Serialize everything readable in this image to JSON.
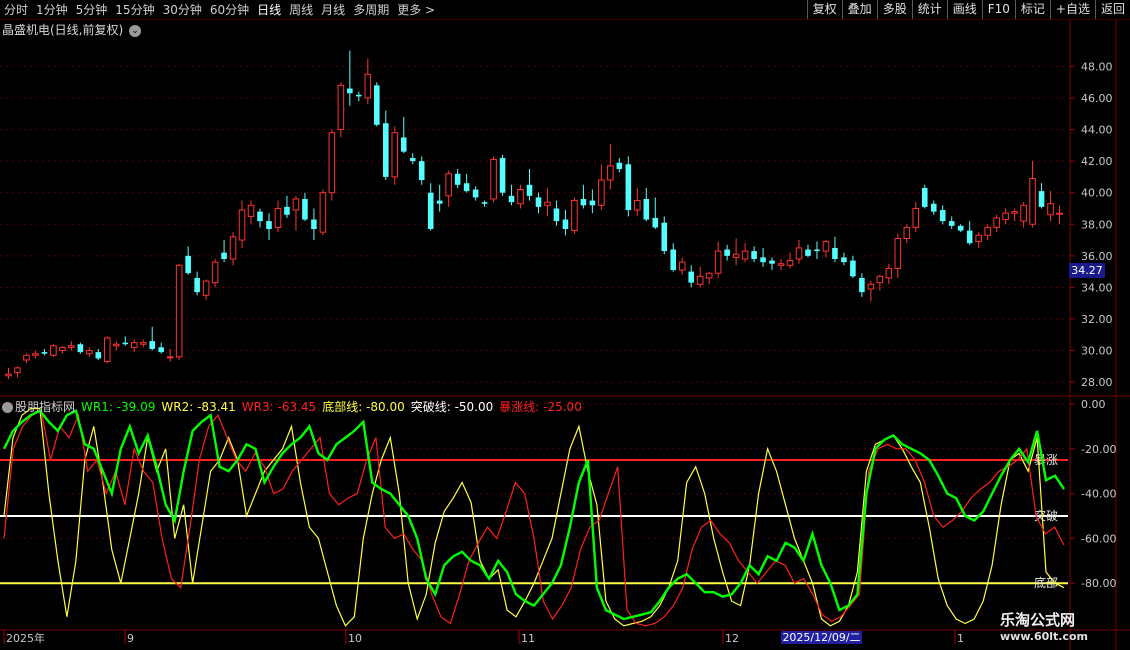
{
  "toolbar": {
    "periods": [
      "分时",
      "1分钟",
      "5分钟",
      "15分钟",
      "30分钟",
      "60分钟",
      "日线",
      "周线",
      "月线",
      "多周期",
      "更多 >"
    ],
    "active_period": "日线",
    "right_buttons": [
      "复权",
      "叠加",
      "多股",
      "统计",
      "画线",
      "F10",
      "标记",
      "+自选",
      "返回"
    ]
  },
  "stock": {
    "title": "晶盛机电(日线,前复权)",
    "current_price_badge": "34.27",
    "price_axis_labels": [
      "48.00",
      "46.00",
      "44.00",
      "42.00",
      "40.00",
      "38.00",
      "36.00",
      "34.00",
      "32.00",
      "30.00",
      "28.00"
    ]
  },
  "indicator": {
    "name": "股朋指标网",
    "wr1": "WR1: -39.09",
    "wr2": "WR2: -83.41",
    "wr3": "WR3: -63.45",
    "bottom_line": "底部线: -80.00",
    "break_line": "突破线: -50.00",
    "surge_line": "暴涨线: -25.00",
    "axis_labels": [
      "0.00",
      "-20.00",
      "-40.00",
      "-60.00",
      "-80.00"
    ],
    "line_labels": {
      "surge": "暴涨",
      "break": "突破",
      "bottom": "底部"
    }
  },
  "time_axis": {
    "labels": [
      "2025年",
      "9",
      "10",
      "11",
      "12",
      "1"
    ],
    "selected_date": "2025/12/09/二"
  },
  "watermark": {
    "line1": "乐淘公式网",
    "line2": "www.60lt.com"
  },
  "colors": {
    "up": "#ff3232",
    "down": "#54ffff",
    "wr1": "#00ff00",
    "wr2": "#ff2020",
    "wr3": "#ffff40",
    "grid": "#5a0000"
  },
  "chart_data": [
    {
      "type": "candlestick",
      "title": "晶盛机电(日线,前复权)",
      "ylim": [
        27.5,
        49.8
      ],
      "candles": [
        [
          28.4,
          28.9,
          28.2,
          28.5
        ],
        [
          28.6,
          29.0,
          28.3,
          28.9
        ],
        [
          29.4,
          29.8,
          29.2,
          29.7
        ],
        [
          29.7,
          30.0,
          29.5,
          29.8
        ],
        [
          29.9,
          30.1,
          29.7,
          29.8
        ],
        [
          29.7,
          30.4,
          29.6,
          30.3
        ],
        [
          30.0,
          30.3,
          29.8,
          30.2
        ],
        [
          30.2,
          30.6,
          30.0,
          30.3
        ],
        [
          30.4,
          30.5,
          29.8,
          29.9
        ],
        [
          29.8,
          30.2,
          29.6,
          30.0
        ],
        [
          29.9,
          30.1,
          29.4,
          29.5
        ],
        [
          29.3,
          30.9,
          29.2,
          30.8
        ],
        [
          30.3,
          30.6,
          30.0,
          30.4
        ],
        [
          30.5,
          30.9,
          30.3,
          30.4
        ],
        [
          30.2,
          30.7,
          29.9,
          30.5
        ],
        [
          30.4,
          30.7,
          30.2,
          30.5
        ],
        [
          30.6,
          31.5,
          30.0,
          30.1
        ],
        [
          30.2,
          30.5,
          29.8,
          29.9
        ],
        [
          29.6,
          30.1,
          29.3,
          29.6
        ],
        [
          29.6,
          35.5,
          29.4,
          35.4
        ],
        [
          36.0,
          36.6,
          34.8,
          34.9
        ],
        [
          34.6,
          35.0,
          33.5,
          33.7
        ],
        [
          33.5,
          34.5,
          33.2,
          34.4
        ],
        [
          34.3,
          35.8,
          34.0,
          35.6
        ],
        [
          36.2,
          37.0,
          35.6,
          35.8
        ],
        [
          35.8,
          37.5,
          35.4,
          37.2
        ],
        [
          37.0,
          39.5,
          36.5,
          38.9
        ],
        [
          38.5,
          39.5,
          38.0,
          39.2
        ],
        [
          38.8,
          39.0,
          37.8,
          38.2
        ],
        [
          38.2,
          38.7,
          37.0,
          37.7
        ],
        [
          37.8,
          39.5,
          37.5,
          39.0
        ],
        [
          39.1,
          39.8,
          38.4,
          38.6
        ],
        [
          38.9,
          39.8,
          37.6,
          39.6
        ],
        [
          39.6,
          40.0,
          38.2,
          38.3
        ],
        [
          38.3,
          39.0,
          37.0,
          37.7
        ],
        [
          37.5,
          40.2,
          37.3,
          40.0
        ],
        [
          40.0,
          44.0,
          39.5,
          43.8
        ],
        [
          44.0,
          47.0,
          43.5,
          46.8
        ],
        [
          46.6,
          49.0,
          45.5,
          46.3
        ],
        [
          46.2,
          46.4,
          45.8,
          46.1
        ],
        [
          46.0,
          48.5,
          45.6,
          47.5
        ],
        [
          46.8,
          47.0,
          44.2,
          44.3
        ],
        [
          44.4,
          45.2,
          40.8,
          41.0
        ],
        [
          41.0,
          44.2,
          40.5,
          43.8
        ],
        [
          43.5,
          44.8,
          42.5,
          42.6
        ],
        [
          42.2,
          42.5,
          41.8,
          42.0
        ],
        [
          42.0,
          42.3,
          40.5,
          40.8
        ],
        [
          40.0,
          40.6,
          37.6,
          37.7
        ],
        [
          39.5,
          40.5,
          38.8,
          39.3
        ],
        [
          39.8,
          41.4,
          39.1,
          41.2
        ],
        [
          41.2,
          41.5,
          40.3,
          40.5
        ],
        [
          40.6,
          41.2,
          40.0,
          40.1
        ],
        [
          40.2,
          40.4,
          39.5,
          39.7
        ],
        [
          39.4,
          39.5,
          39.1,
          39.3
        ],
        [
          39.6,
          42.3,
          39.4,
          42.1
        ],
        [
          42.2,
          42.4,
          39.8,
          40.0
        ],
        [
          39.8,
          40.5,
          39.2,
          39.4
        ],
        [
          39.3,
          40.5,
          39.0,
          40.2
        ],
        [
          40.5,
          41.5,
          39.5,
          39.8
        ],
        [
          39.7,
          40.0,
          38.7,
          39.1
        ],
        [
          39.2,
          40.3,
          38.5,
          39.4
        ],
        [
          39.0,
          39.5,
          37.9,
          38.2
        ],
        [
          38.3,
          38.9,
          37.3,
          37.7
        ],
        [
          37.6,
          39.7,
          37.4,
          39.5
        ],
        [
          39.6,
          40.5,
          39.0,
          39.2
        ],
        [
          39.5,
          40.2,
          38.7,
          39.2
        ],
        [
          39.2,
          41.8,
          38.9,
          40.8
        ],
        [
          40.8,
          43.1,
          40.2,
          41.7
        ],
        [
          41.9,
          42.2,
          41.3,
          41.5
        ],
        [
          41.8,
          42.3,
          38.5,
          38.9
        ],
        [
          38.9,
          40.3,
          38.5,
          39.5
        ],
        [
          39.6,
          40.3,
          38.2,
          38.3
        ],
        [
          38.4,
          39.7,
          37.7,
          37.8
        ],
        [
          38.1,
          38.5,
          36.1,
          36.3
        ],
        [
          36.4,
          36.8,
          35.0,
          35.1
        ],
        [
          35.1,
          35.9,
          34.8,
          35.6
        ],
        [
          35.0,
          35.4,
          34.0,
          34.3
        ],
        [
          34.2,
          35.3,
          34.0,
          34.7
        ],
        [
          34.6,
          35.0,
          34.2,
          34.9
        ],
        [
          34.9,
          36.9,
          34.6,
          36.3
        ],
        [
          36.4,
          36.7,
          35.7,
          36.0
        ],
        [
          35.9,
          37.1,
          35.4,
          36.1
        ],
        [
          35.8,
          36.8,
          35.6,
          36.3
        ],
        [
          36.3,
          36.6,
          35.6,
          35.8
        ],
        [
          35.9,
          36.5,
          35.3,
          35.6
        ],
        [
          35.7,
          35.9,
          35.1,
          35.5
        ],
        [
          35.4,
          35.8,
          35.1,
          35.5
        ],
        [
          35.4,
          36.2,
          35.2,
          35.7
        ],
        [
          35.8,
          37.0,
          35.5,
          36.5
        ],
        [
          36.4,
          36.7,
          35.9,
          36.0
        ],
        [
          36.4,
          36.9,
          35.8,
          36.3
        ],
        [
          36.3,
          37.0,
          35.9,
          36.9
        ],
        [
          36.5,
          37.2,
          35.6,
          35.8
        ],
        [
          35.9,
          36.2,
          35.4,
          35.6
        ],
        [
          35.7,
          36.0,
          34.6,
          34.7
        ],
        [
          34.6,
          34.9,
          33.4,
          33.7
        ],
        [
          33.9,
          34.4,
          33.1,
          34.2
        ],
        [
          34.3,
          34.8,
          33.8,
          34.7
        ],
        [
          34.6,
          35.5,
          34.2,
          35.2
        ],
        [
          35.2,
          37.4,
          34.6,
          37.1
        ],
        [
          37.1,
          38.0,
          36.8,
          37.8
        ],
        [
          37.8,
          39.4,
          37.5,
          39.0
        ],
        [
          40.3,
          40.5,
          39.0,
          39.1
        ],
        [
          39.3,
          39.5,
          38.6,
          38.8
        ],
        [
          38.9,
          39.2,
          38.0,
          38.2
        ],
        [
          38.2,
          38.5,
          37.7,
          37.9
        ],
        [
          37.9,
          38.0,
          37.5,
          37.6
        ],
        [
          37.6,
          38.2,
          36.7,
          36.8
        ],
        [
          36.9,
          37.5,
          36.5,
          37.3
        ],
        [
          37.3,
          38.0,
          37.0,
          37.8
        ],
        [
          37.8,
          38.6,
          37.5,
          38.4
        ],
        [
          38.3,
          39.0,
          38.0,
          38.7
        ],
        [
          38.7,
          39.0,
          38.2,
          38.8
        ],
        [
          38.2,
          39.4,
          37.8,
          39.2
        ],
        [
          38.0,
          42.0,
          37.8,
          40.9
        ],
        [
          40.1,
          40.6,
          39.0,
          39.1
        ],
        [
          38.6,
          40.1,
          38.2,
          39.3
        ],
        [
          38.7,
          39.2,
          38.0,
          38.7
        ]
      ]
    },
    {
      "type": "line",
      "title": "股朋指标网",
      "ylim": [
        -100,
        0
      ],
      "series": [
        {
          "name": "WR1",
          "values": [
            -20,
            -12,
            -8,
            -5,
            -3,
            -8,
            -12,
            -5,
            -3,
            -18,
            -20,
            -30,
            -40,
            -20,
            -10,
            -22,
            -14,
            -28,
            -45,
            -52,
            -30,
            -12,
            -8,
            -5,
            -28,
            -30,
            -25,
            -18,
            -20,
            -35,
            -28,
            -22,
            -18,
            -15,
            -10,
            -22,
            -25,
            -18,
            -15,
            -12,
            -8,
            -35,
            -38,
            -40,
            -45,
            -50,
            -60,
            -78,
            -85,
            -72,
            -68,
            -66,
            -70,
            -72,
            -78,
            -70,
            -75,
            -85,
            -88,
            -90,
            -85,
            -80,
            -72,
            -55,
            -35,
            -25,
            -82,
            -92,
            -94,
            -96,
            -95,
            -94,
            -93,
            -88,
            -82,
            -78,
            -76,
            -80,
            -84,
            -84,
            -86,
            -85,
            -80,
            -72,
            -76,
            -68,
            -70,
            -62,
            -64,
            -70,
            -58,
            -72,
            -80,
            -92,
            -90,
            -85,
            -40,
            -20,
            -16,
            -14,
            -18,
            -20,
            -22,
            -25,
            -32,
            -40,
            -42,
            -50,
            -52,
            -48,
            -40,
            -32,
            -25,
            -20,
            -26,
            -12,
            -34,
            -32,
            -38
          ]
        },
        {
          "name": "WR2",
          "values": [
            -60,
            -20,
            -10,
            -5,
            -3,
            -25,
            -10,
            -15,
            -5,
            -30,
            -25,
            -40,
            -30,
            -45,
            -20,
            -30,
            -35,
            -60,
            -78,
            -82,
            -55,
            -25,
            -10,
            -5,
            -15,
            -25,
            -30,
            -22,
            -28,
            -40,
            -38,
            -30,
            -25,
            -20,
            -15,
            -40,
            -45,
            -42,
            -40,
            -25,
            -15,
            -55,
            -60,
            -58,
            -65,
            -70,
            -85,
            -95,
            -98,
            -85,
            -70,
            -62,
            -55,
            -60,
            -48,
            -35,
            -40,
            -60,
            -88,
            -96,
            -90,
            -82,
            -65,
            -55,
            -52,
            -40,
            -28,
            -92,
            -98,
            -99,
            -98,
            -95,
            -90,
            -82,
            -65,
            -55,
            -52,
            -58,
            -62,
            -70,
            -75,
            -80,
            -75,
            -70,
            -72,
            -80,
            -78,
            -85,
            -94,
            -97,
            -95,
            -90,
            -85,
            -30,
            -20,
            -18,
            -20,
            -20,
            -25,
            -35,
            -50,
            -55,
            -52,
            -48,
            -42,
            -38,
            -35,
            -30,
            -28,
            -25,
            -20,
            -50,
            -58,
            -55,
            -63
          ]
        },
        {
          "name": "WR3",
          "values": [
            -50,
            -15,
            -5,
            -2,
            -2,
            -40,
            -70,
            -95,
            -70,
            -25,
            -10,
            -35,
            -65,
            -80,
            -60,
            -40,
            -15,
            -30,
            -20,
            -60,
            -45,
            -80,
            -55,
            -30,
            -25,
            -15,
            -25,
            -50,
            -40,
            -30,
            -25,
            -20,
            -10,
            -35,
            -55,
            -60,
            -75,
            -90,
            -99,
            -95,
            -60,
            -40,
            -25,
            -15,
            -40,
            -80,
            -96,
            -85,
            -62,
            -48,
            -42,
            -35,
            -44,
            -70,
            -78,
            -74,
            -92,
            -95,
            -88,
            -80,
            -70,
            -60,
            -40,
            -20,
            -10,
            -30,
            -45,
            -88,
            -96,
            -99,
            -98,
            -97,
            -95,
            -90,
            -82,
            -70,
            -35,
            -28,
            -40,
            -60,
            -75,
            -88,
            -90,
            -72,
            -40,
            -20,
            -30,
            -45,
            -60,
            -70,
            -80,
            -96,
            -99,
            -97,
            -90,
            -75,
            -30,
            -18,
            -16,
            -14,
            -20,
            -28,
            -35,
            -55,
            -78,
            -90,
            -96,
            -98,
            -96,
            -88,
            -72,
            -45,
            -25,
            -22,
            -30,
            -15,
            -75,
            -80,
            -82
          ]
        }
      ],
      "reference_lines": {
        "bottom": -80,
        "break": -50,
        "surge": -25
      }
    }
  ]
}
